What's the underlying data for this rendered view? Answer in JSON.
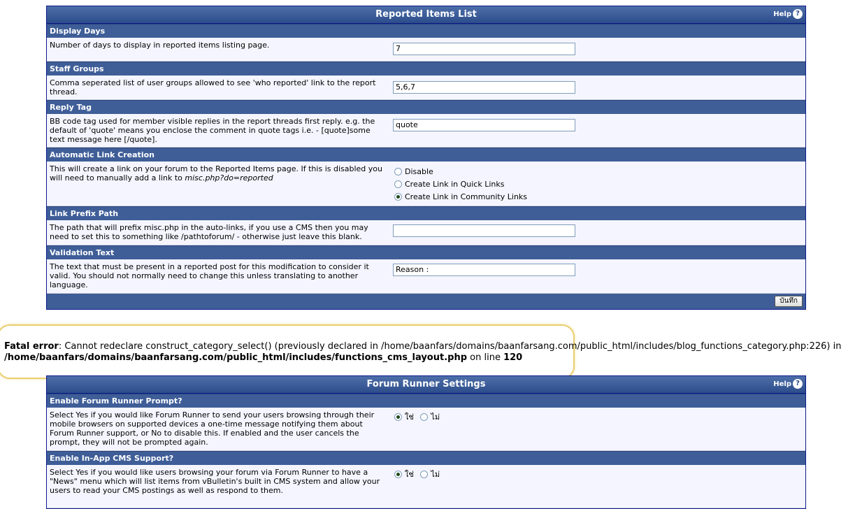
{
  "panel1": {
    "title": "Reported Items List",
    "help": "Help",
    "sections": {
      "display_days": {
        "title": "Display Days",
        "desc": "Number of days to display in reported items listing page.",
        "value": "7"
      },
      "staff_groups": {
        "title": "Staff Groups",
        "desc": "Comma seperated list of user groups allowed to see 'who reported' link to the report thread.",
        "value": "5,6,7"
      },
      "reply_tag": {
        "title": "Reply Tag",
        "desc": "BB code tag used for member visible replies in the report threads first reply. e.g. the default of 'quote' means you enclose the comment in quote tags i.e. - [quote]some text message here [/quote].",
        "value": "quote"
      },
      "auto_link": {
        "title": "Automatic Link Creation",
        "desc": "This will create a link on your forum to the Reported Items page. If this is disabled you will need to manually add a link to ",
        "desc_link": "misc.php?do=reported",
        "options": [
          "Disable",
          "Create Link in Quick Links",
          "Create Link in Community Links"
        ],
        "selected": 2
      },
      "link_prefix": {
        "title": "Link Prefix Path",
        "desc": "The path that will prefix misc.php in the auto-links, if you use a CMS then you may need to set this to something like /pathtoforum/ - otherwise just leave this blank.",
        "value": ""
      },
      "validation": {
        "title": "Validation Text",
        "desc": "The text that must be present in a reported post for this modification to consider it valid. You should not normally need to change this unless translating to another language.",
        "value": "Reason :"
      }
    },
    "save_label": "บันทึก"
  },
  "error": {
    "label": "Fatal error",
    "message": ": Cannot redeclare construct_category_select() (previously declared in /home/baanfars/domains/baanfarsang.com/public_html/includes/blog_functions_category.php:226) in",
    "path": "/home/baanfars/domains/baanfarsang.com/public_html/includes/functions_cms_layout.php",
    "on_line": " on line ",
    "line": "120"
  },
  "panel2": {
    "title": "Forum Runner Settings",
    "help": "Help",
    "sections": {
      "prompt": {
        "title": "Enable Forum Runner Prompt?",
        "desc": "Select Yes if you would like Forum Runner to send your users browsing through their mobile browsers on supported devices a one-time message notifying them about Forum Runner support, or No to disable this. If enabled and the user cancels the prompt, they will not be prompted again.",
        "yes": "ใช่",
        "no": "ไม่",
        "selected": "yes"
      },
      "cms": {
        "title": "Enable In-App CMS Support?",
        "desc": "Select Yes if you would like users browsing your forum via Forum Runner to have a \"News\" menu which will list items from vBulletin's built in CMS system and allow your users to read your CMS postings as well as respond to them.",
        "yes": "ใช่",
        "no": "ไม่",
        "selected": "yes"
      }
    }
  }
}
